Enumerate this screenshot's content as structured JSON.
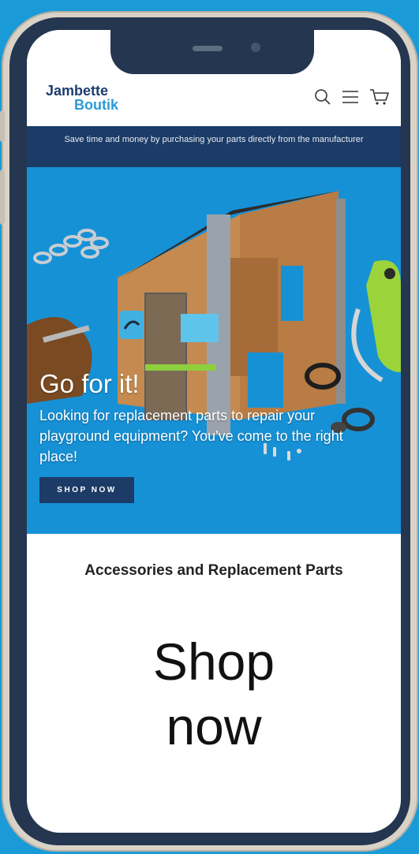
{
  "brand": {
    "line1": "Jambette",
    "line2": "Boutik",
    "color_primary": "#1c3d6c",
    "color_secondary": "#2b9ad8"
  },
  "header_icons": [
    "search-icon",
    "menu-icon",
    "cart-icon"
  ],
  "announcement": {
    "text": "Save time and money by purchasing your parts directly from the manufacturer"
  },
  "hero": {
    "title": "Go for it!",
    "subtitle": "Looking for replacement parts to repair your playground equipment? You've come to the right place!",
    "button_label": "SHOP NOW"
  },
  "collection": {
    "heading": "Accessories and Replacement Parts",
    "tile_text_line1": "Shop",
    "tile_text_line2": "now"
  },
  "colors": {
    "background": "#1a9ad6",
    "navy": "#1c3b66",
    "hero_blue": "#1791d6"
  }
}
